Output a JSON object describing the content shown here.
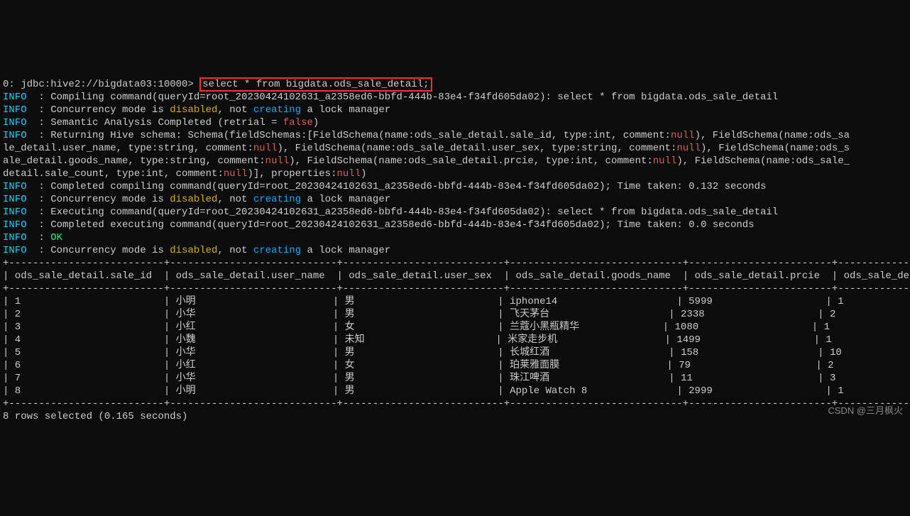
{
  "prompt_prefix": "0: jdbc:hive2://bigdata03:10000> ",
  "sql_command": "select * from bigdata.ods_sale_detail;",
  "log": {
    "l1a": "INFO",
    "l1b": "  : Compiling command(queryId=root_20230424102631_a2358ed6-bbfd-444b-83e4-f34fd605da02): select * from bigdata.ods_sale_detail",
    "l2a": "INFO",
    "l2b": "  : Concurrency mode is ",
    "l2c": "disabled",
    "l2d": ", not ",
    "l2e": "creating",
    "l2f": " a lock manager",
    "l3a": "INFO",
    "l3b": "  : Semantic Analysis Completed (retrial = ",
    "l3c": "false",
    "l3d": ")",
    "l4a": "INFO",
    "l4b": "  : Returning Hive schema: Schema(fieldSchemas:[FieldSchema(name:ods_sale_detail.sale_id, type:int, comment:",
    "l4c": "null",
    "l4d": "), FieldSchema(name:ods_sa",
    "l5a": "le_detail.user_name, type:string, comment:",
    "l5b": "null",
    "l5c": "), FieldSchema(name:ods_sale_detail.user_sex, type:string, comment:",
    "l5d": "null",
    "l5e": "), FieldSchema(name:ods_s",
    "l6a": "ale_detail.goods_name, type:string, comment:",
    "l6b": "null",
    "l6c": "), FieldSchema(name:ods_sale_detail.prcie, type:int, comment:",
    "l6d": "null",
    "l6e": "), FieldSchema(name:ods_sale_",
    "l7a": "detail.sale_count, type:int, comment:",
    "l7b": "null",
    "l7c": ")], properties:",
    "l7d": "null",
    "l7e": ")",
    "l8a": "INFO",
    "l8b": "  : Completed compiling command(queryId=root_20230424102631_a2358ed6-bbfd-444b-83e4-f34fd605da02); Time taken: 0.132 seconds",
    "l9a": "INFO",
    "l9b": "  : Concurrency mode is ",
    "l9c": "disabled",
    "l9d": ", not ",
    "l9e": "creating",
    "l9f": " a lock manager",
    "l10a": "INFO",
    "l10b": "  : Executing command(queryId=root_20230424102631_a2358ed6-bbfd-444b-83e4-f34fd605da02): select * from bigdata.ods_sale_detail",
    "l11a": "INFO",
    "l11b": "  : Completed executing command(queryId=root_20230424102631_a2358ed6-bbfd-444b-83e4-f34fd605da02); Time taken: 0.0 seconds",
    "l12a": "INFO",
    "l12b": "  : ",
    "l12c": "OK",
    "l13a": "INFO",
    "l13b": "  : Concurrency mode is ",
    "l13c": "disabled",
    "l13d": ", not ",
    "l13e": "creating",
    "l13f": " a lock manager"
  },
  "sep": "+--------------------------+----------------------------+---------------------------+-----------------------------+------------------------+-----------------------------+",
  "hdr1": "| ods_sale_detail.sale_id  | ods_sale_detail.user_name  | ods_sale_detail.user_sex  | ods_sale_detail.goods_name  | ods_sale_detail.prcie  | ods_sale_detail.sale_count  |",
  "rows": [
    "| 1                        | 小明                       | 男                        | iphone14                    | 5999                   | 1                           |",
    "| 2                        | 小华                       | 男                        | 飞天茅台                    | 2338                   | 2                           |",
    "| 3                        | 小红                       | 女                        | 兰蔻小黑瓶精华              | 1080                   | 1                           |",
    "| 4                        | 小魏                       | 未知                      | 米家走步机                  | 1499                   | 1                           |",
    "| 5                        | 小华                       | 男                        | 长城红酒                    | 158                    | 10                          |",
    "| 6                        | 小红                       | 女                        | 珀莱雅面膜                  | 79                     | 2                           |",
    "| 7                        | 小华                       | 男                        | 珠江啤酒                    | 11                     | 3                           |",
    "| 8                        | 小明                       | 男                        | Apple Watch 8               | 2999                   | 1                           |"
  ],
  "footer": "8 rows selected (0.165 seconds)",
  "watermark": "CSDN @三月枫火",
  "chart_data": {
    "type": "table",
    "columns": [
      "ods_sale_detail.sale_id",
      "ods_sale_detail.user_name",
      "ods_sale_detail.user_sex",
      "ods_sale_detail.goods_name",
      "ods_sale_detail.prcie",
      "ods_sale_detail.sale_count"
    ],
    "data": [
      [
        1,
        "小明",
        "男",
        "iphone14",
        5999,
        1
      ],
      [
        2,
        "小华",
        "男",
        "飞天茅台",
        2338,
        2
      ],
      [
        3,
        "小红",
        "女",
        "兰蔻小黑瓶精华",
        1080,
        1
      ],
      [
        4,
        "小魏",
        "未知",
        "米家走步机",
        1499,
        1
      ],
      [
        5,
        "小华",
        "男",
        "长城红酒",
        158,
        10
      ],
      [
        6,
        "小红",
        "女",
        "珀莱雅面膜",
        79,
        2
      ],
      [
        7,
        "小华",
        "男",
        "珠江啤酒",
        11,
        3
      ],
      [
        8,
        "小明",
        "男",
        "Apple Watch 8",
        2999,
        1
      ]
    ]
  }
}
